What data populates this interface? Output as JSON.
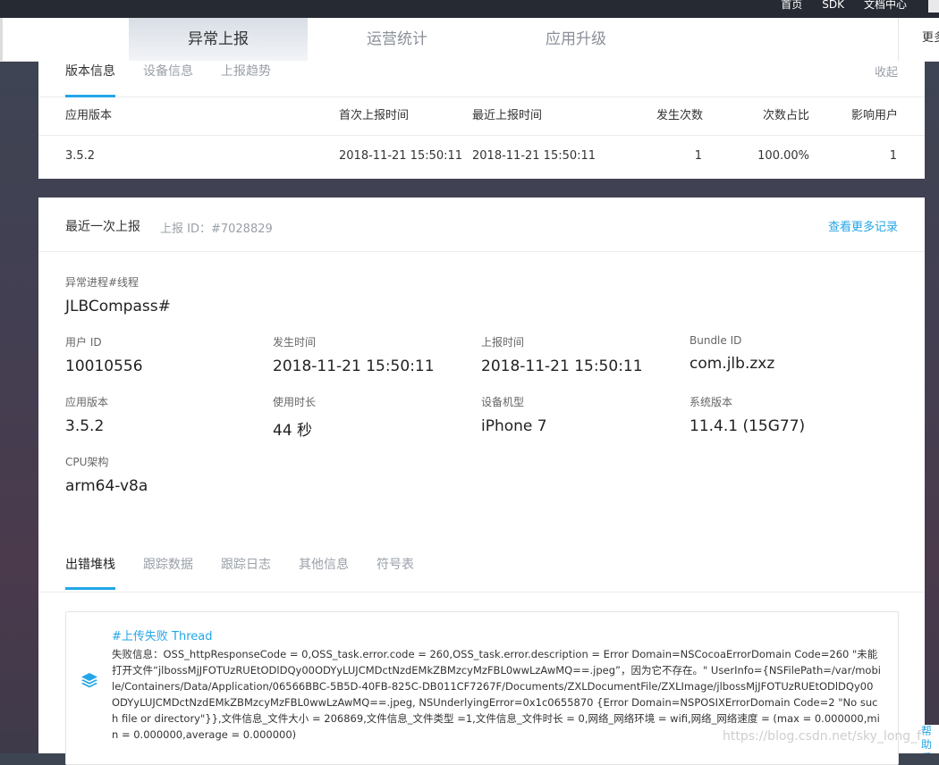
{
  "topbar": {
    "links": [
      "首页",
      "SDK",
      "文档中心"
    ]
  },
  "tabs": {
    "items": [
      "异常上报",
      "运营统计",
      "应用升级"
    ],
    "more": "更多"
  },
  "version_card": {
    "subtabs": [
      "版本信息",
      "设备信息",
      "上报趋势"
    ],
    "collapse": "收起",
    "columns": [
      "应用版本",
      "首次上报时间",
      "最近上报时间",
      "发生次数",
      "次数占比",
      "影响用户"
    ],
    "row": [
      "3.5.2",
      "2018-11-21 15:50:11",
      "2018-11-21 15:50:11",
      "1",
      "100.00%",
      "1"
    ]
  },
  "report_card": {
    "title": "最近一次上报",
    "report_id": "上报 ID：#7028829",
    "more_records": "查看更多记录",
    "process": {
      "label": "异常进程#线程",
      "value": "JLBCompass#"
    },
    "fields": [
      {
        "label": "用户 ID",
        "value": "10010556"
      },
      {
        "label": "发生时间",
        "value": "2018-11-21 15:50:11"
      },
      {
        "label": "上报时间",
        "value": "2018-11-21 15:50:11"
      },
      {
        "label": "Bundle ID",
        "value": "com.jlb.zxz"
      },
      {
        "label": "应用版本",
        "value": "3.5.2"
      },
      {
        "label": "使用时长",
        "value": "44 秒"
      },
      {
        "label": "设备机型",
        "value": "iPhone 7"
      },
      {
        "label": "系统版本",
        "value": "11.4.1 (15G77)"
      },
      {
        "label": "CPU架构",
        "value": "arm64-v8a"
      }
    ],
    "bottom_tabs": [
      "出错堆栈",
      "跟踪数据",
      "跟踪日志",
      "其他信息",
      "符号表"
    ],
    "stack": {
      "title": "#上传失败 Thread",
      "text": "失败信息：OSS_httpResponseCode = 0,OSS_task.error.code = 260,OSS_task.error.description = Error Domain=NSCocoaErrorDomain Code=260 \"未能打开文件“jlbossMjJFOTUzRUEtODlDQy00ODYyLUJCMDctNzdEMkZBMzcyMzFBL0wwLzAwMQ==.jpeg”，因为它不存在。\" UserInfo={NSFilePath=/var/mobile/Containers/Data/Application/06566BBC-5B5D-40FB-825C-DB011CF7267F/Documents/ZXLDocumentFile/ZXLImage/jlbossMjJFOTUzRUEtODlDQy00ODYyLUJCMDctNzdEMkZBMzcyMzFBL0wwLzAwMQ==.jpeg, NSUnderlyingError=0x1c0655870 {Error Domain=NSPOSIXErrorDomain Code=2 \"No such file or directory\"}},文件信息_文件大小 = 206869,文件信息_文件类型 =1,文件信息_文件时长 = 0,网络_网络环境 = wifi,网络_网络速度 = (max = 0.000000,min = 0.000000,average = 0.000000)"
    }
  },
  "watermark": "https://blog.csdn.net/sky_long_f",
  "help": "帮助反馈",
  "colors": {
    "accent": "#23a6e8",
    "topbar": "#262a33",
    "background": "#423f52"
  }
}
